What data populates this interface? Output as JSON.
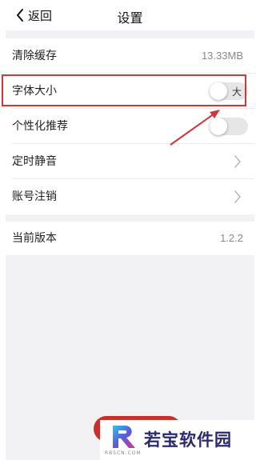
{
  "header": {
    "back_label": "返回",
    "title": "设置"
  },
  "section1": {
    "items": [
      {
        "label": "清除缓存",
        "value": "13.33MB"
      },
      {
        "label": "字体大小",
        "toggle_text": "大",
        "toggle_on": false
      },
      {
        "label": "个性化推荐",
        "toggle_on": false
      },
      {
        "label": "定时静音"
      },
      {
        "label": "账号注销"
      }
    ]
  },
  "section2": {
    "label": "当前版本",
    "value": "1.2.2"
  },
  "colors": {
    "highlight": "#d0363b",
    "background": "#f2f2f4",
    "action_button": "#c9302c"
  },
  "icons": [
    "chevron-left-icon",
    "chevron-right-icon",
    "annotation-arrow",
    "watermark-logo"
  ],
  "watermark": {
    "text": "若宝软件园",
    "subtext": "RBSCN.COM"
  }
}
